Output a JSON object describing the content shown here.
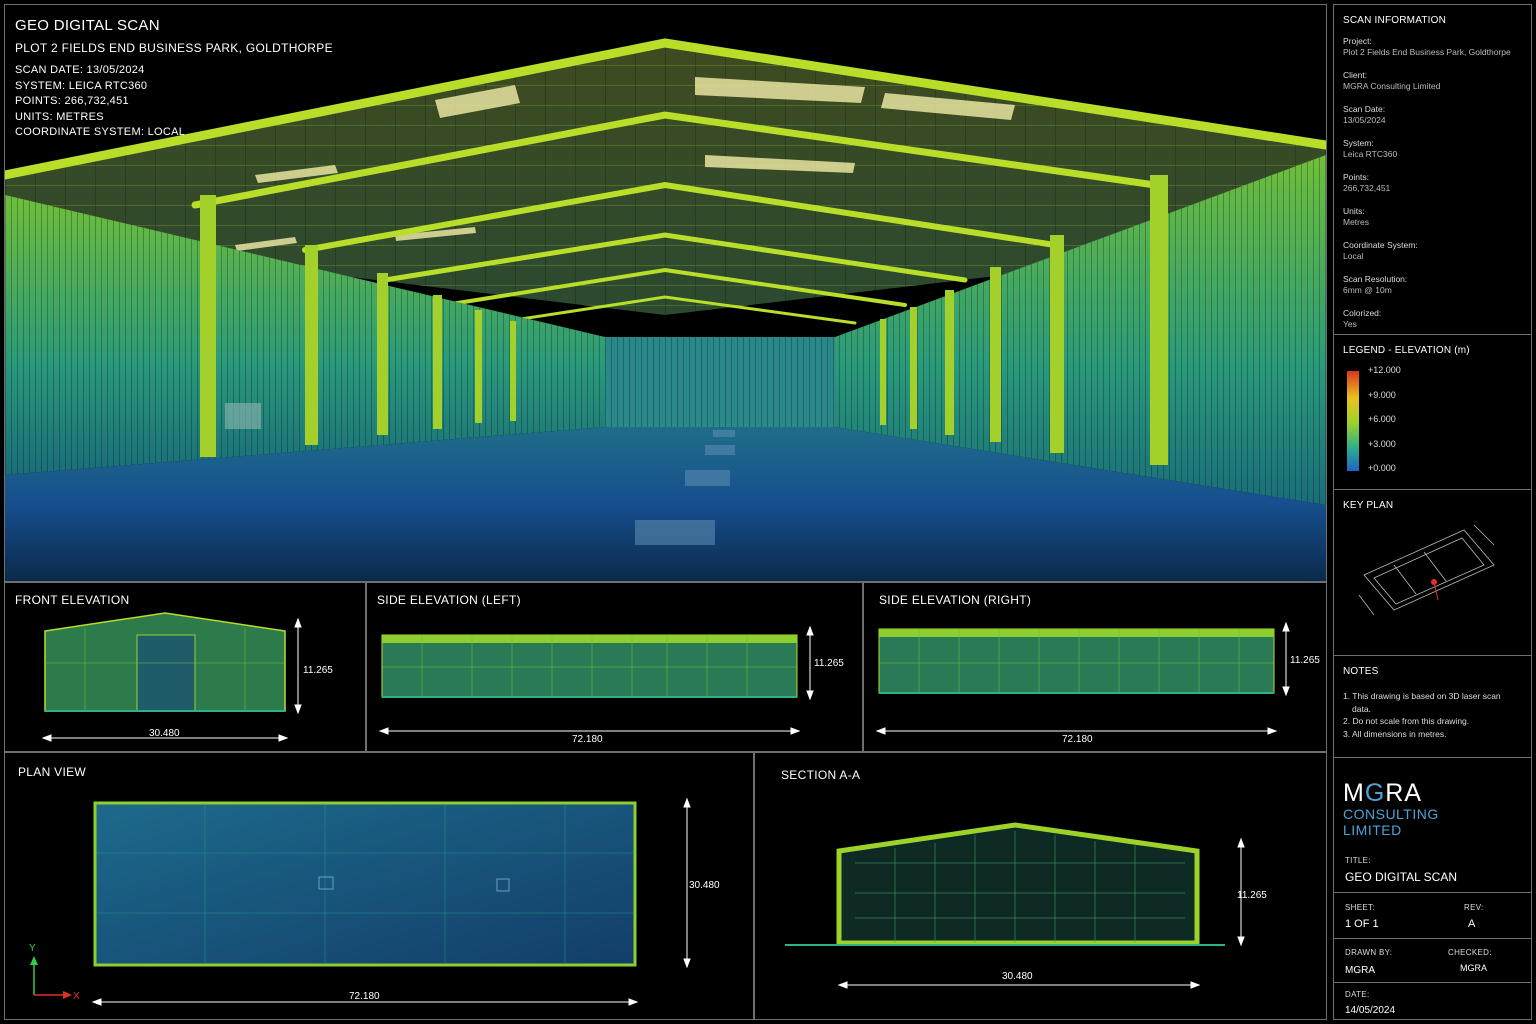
{
  "header": {
    "title": "GEO DIGITAL SCAN",
    "subtitle": "PLOT 2 FIELDS END BUSINESS PARK, GOLDTHORPE",
    "lines": [
      "SCAN DATE: 13/05/2024",
      "SYSTEM: LEICA RTC360",
      "POINTS: 266,732,451",
      "UNITS: METRES",
      "COORDINATE SYSTEM: LOCAL"
    ]
  },
  "panels": {
    "front": {
      "title": "FRONT ELEVATION",
      "width": "30.480",
      "height": "11.265"
    },
    "left": {
      "title": "SIDE ELEVATION (LEFT)",
      "width": "72.180",
      "height": "11.265"
    },
    "right": {
      "title": "SIDE ELEVATION (RIGHT)",
      "width": "72.180",
      "height": "11.265"
    },
    "plan": {
      "title": "PLAN VIEW",
      "width": "72.180",
      "height": "30.480",
      "axis_y": "Y",
      "axis_x": "X"
    },
    "section": {
      "title": "SECTION A-A",
      "width": "30.480",
      "height": "11.265"
    }
  },
  "scan_info": {
    "title": "SCAN INFORMATION",
    "items": [
      {
        "label": "Project:",
        "value": "Plot 2 Fields End Business Park, Goldthorpe"
      },
      {
        "label": "Client:",
        "value": "MGRA Consulting Limited"
      },
      {
        "label": "Scan Date:",
        "value": "13/05/2024"
      },
      {
        "label": "System:",
        "value": "Leica RTC360"
      },
      {
        "label": "Points:",
        "value": "266,732,451"
      },
      {
        "label": "Units:",
        "value": "Metres"
      },
      {
        "label": "Coordinate System:",
        "value": "Local"
      },
      {
        "label": "Scan Resolution:",
        "value": "6mm @ 10m"
      },
      {
        "label": "Colorized:",
        "value": "Yes"
      }
    ]
  },
  "legend": {
    "title": "LEGEND - ELEVATION (m)",
    "labels": [
      "+12.000",
      "+9.000",
      "+6.000",
      "+3.000",
      "+0.000"
    ],
    "colors": [
      "#d9331f",
      "#e8c21c",
      "#9dd22a",
      "#2fb08a",
      "#1f64c4"
    ]
  },
  "key_plan": {
    "title": "KEY PLAN"
  },
  "notes": {
    "title": "NOTES",
    "items": [
      "1. This drawing is based on 3D laser scan data.",
      "2. Do not scale from this drawing.",
      "3. All dimensions in metres."
    ]
  },
  "title_block": {
    "logo_line1_a": "M",
    "logo_line1_b": "G",
    "logo_line1_c": "RA",
    "logo_line2": "CONSULTING",
    "logo_line3": "LIMITED",
    "title_label": "TITLE:",
    "title_value": "GEO DIGITAL SCAN",
    "sheet_label": "SHEET:",
    "sheet_value": "1 OF 1",
    "rev_label": "REV:",
    "rev_value": "A",
    "drawn_label": "DRAWN BY:",
    "drawn_value": "MGRA",
    "checked_label": "CHECKED:",
    "checked_value": "MGRA",
    "date_label": "DATE:",
    "date_value": "14/05/2024"
  },
  "colors": {
    "accent_blue": "#4aa3d8",
    "border": "#6f6f6f"
  }
}
